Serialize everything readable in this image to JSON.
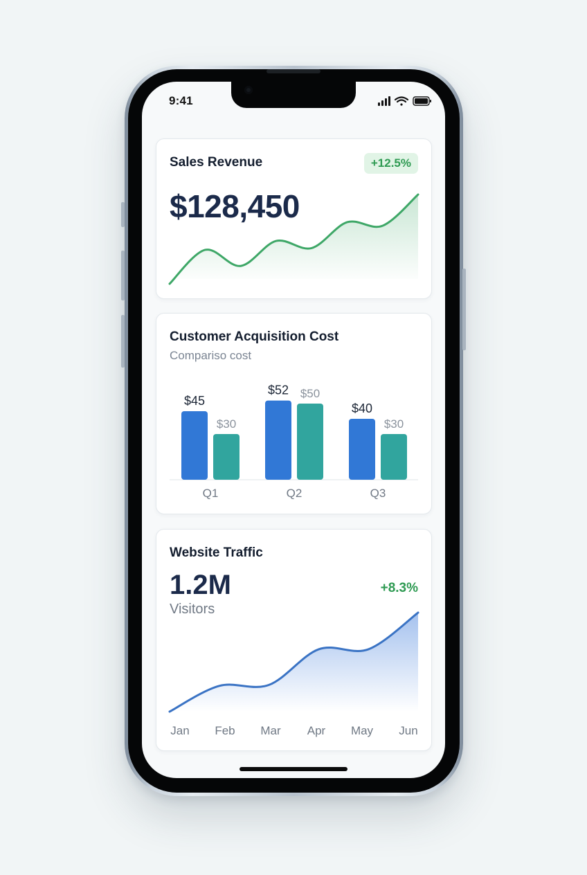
{
  "status_bar": {
    "time": "9:41"
  },
  "sales_card": {
    "title": "Sales Revenue",
    "badge": "+12.5%",
    "value": "$128,450",
    "accent": "#3ea767"
  },
  "cac_card": {
    "title": "Customer Acquisition Cost",
    "subtitle": "Compariso cost",
    "colors": [
      "#3178d6",
      "#31a59e"
    ]
  },
  "traffic_card": {
    "title": "Website Traffic",
    "value": "1.2M",
    "change": "+8.3%",
    "subtitle": "Visitors",
    "accent": "#3a73c4"
  },
  "chart_data": [
    {
      "type": "area",
      "x": [
        0,
        1,
        2,
        3,
        4,
        5,
        6,
        7
      ],
      "values": [
        0.0,
        0.38,
        0.2,
        0.48,
        0.4,
        0.69,
        0.65,
        1.0
      ],
      "title": "",
      "xlabel": "",
      "ylabel": ""
    },
    {
      "type": "bar",
      "categories": [
        "Q1",
        "Q2",
        "Q3"
      ],
      "series": [
        {
          "values": [
            45,
            52,
            40
          ],
          "labels": [
            "$45",
            "$52",
            "$40"
          ]
        },
        {
          "values": [
            30,
            50,
            30
          ],
          "labels": [
            "$30",
            "$50",
            "$30"
          ]
        }
      ],
      "ylim": [
        0,
        60
      ]
    },
    {
      "type": "area",
      "categories": [
        "Jan",
        "Feb",
        "Mar",
        "Apr",
        "May",
        "Jun"
      ],
      "values": [
        0.0,
        0.26,
        0.27,
        0.63,
        0.63,
        1.0
      ]
    }
  ]
}
